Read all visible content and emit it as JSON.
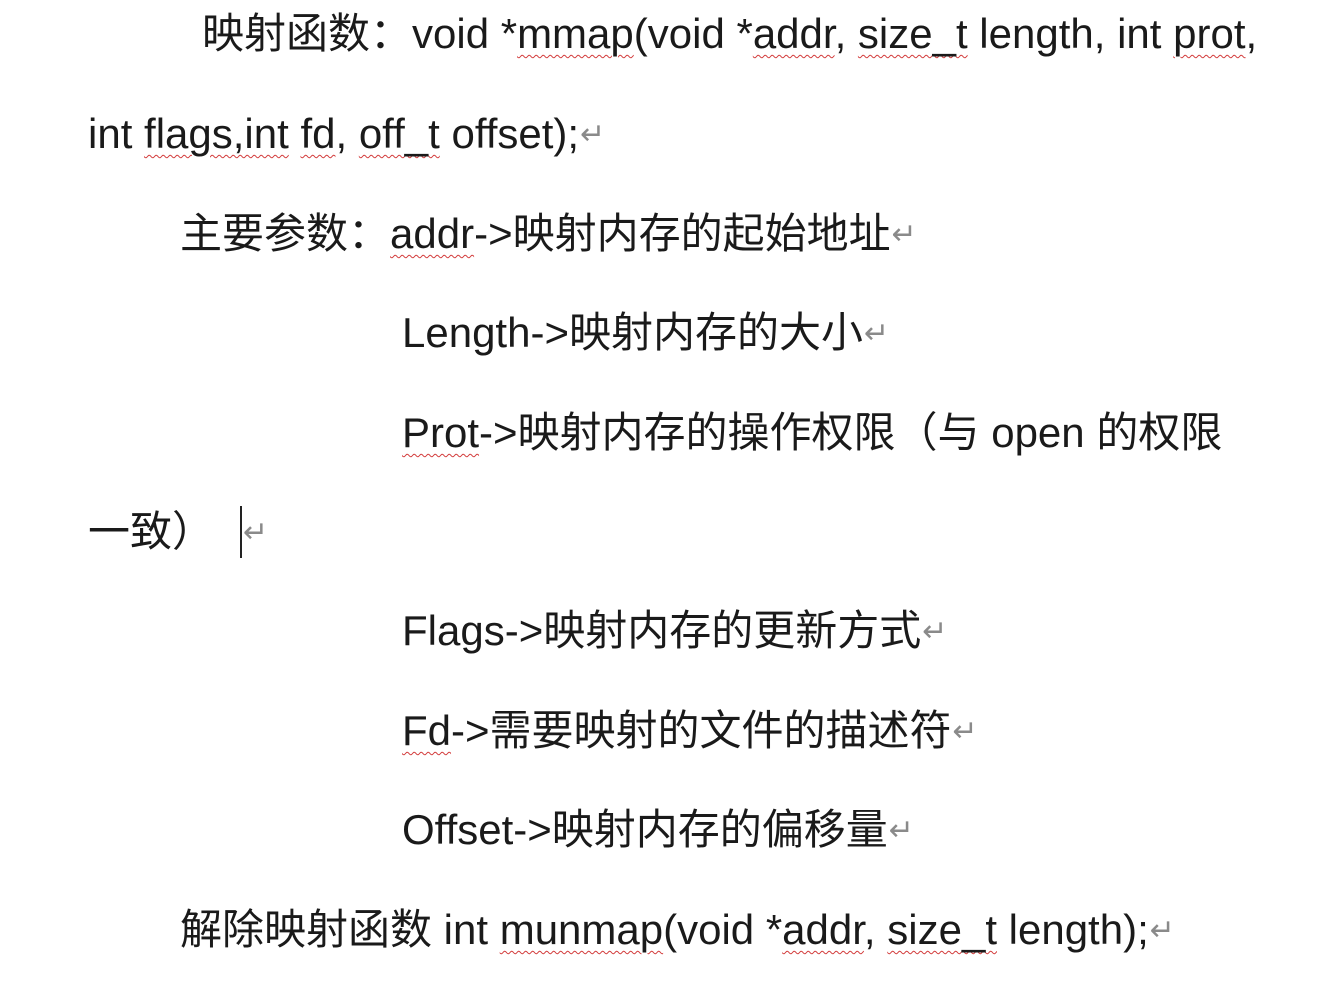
{
  "document": {
    "paragraphs": [
      {
        "id": "mmap-signature",
        "lines": [
          {
            "segments": [
              {
                "text": "映射函数：void *",
                "squiggle": false
              },
              {
                "text": "mmap",
                "squiggle": true
              },
              {
                "text": "(void *",
                "squiggle": false
              },
              {
                "text": "addr",
                "squiggle": true
              },
              {
                "text": ", ",
                "squiggle": false
              },
              {
                "text": "size_t",
                "squiggle": true
              },
              {
                "text": " length, int ",
                "squiggle": false
              },
              {
                "text": "prot",
                "squiggle": true
              },
              {
                "text": ",",
                "squiggle": false
              }
            ]
          },
          {
            "segments": [
              {
                "text": "int ",
                "squiggle": false
              },
              {
                "text": "flags,int",
                "squiggle": true
              },
              {
                "text": " ",
                "squiggle": false
              },
              {
                "text": "fd",
                "squiggle": true
              },
              {
                "text": ", ",
                "squiggle": false
              },
              {
                "text": "off_t",
                "squiggle": true
              },
              {
                "text": " offset);",
                "squiggle": false
              }
            ],
            "mark": "↵"
          }
        ]
      },
      {
        "id": "param-addr",
        "lines": [
          {
            "segments": [
              {
                "text": "主要参数：",
                "squiggle": false
              },
              {
                "text": "addr",
                "squiggle": true
              },
              {
                "text": "->映射内存的起始地址",
                "squiggle": false
              }
            ],
            "mark": "↵"
          }
        ]
      },
      {
        "id": "param-length",
        "lines": [
          {
            "segments": [
              {
                "text": "Length->映射内存的大小",
                "squiggle": false
              }
            ],
            "mark": "↵"
          }
        ]
      },
      {
        "id": "param-prot",
        "lines": [
          {
            "segments": [
              {
                "text": "Prot",
                "squiggle": true
              },
              {
                "text": "->映射内存的操作权限（与 open 的权限",
                "squiggle": false
              }
            ]
          },
          {
            "segments": [
              {
                "text": "一致）",
                "squiggle": false
              }
            ],
            "mark": "↵",
            "caret": true
          }
        ]
      },
      {
        "id": "param-flags",
        "lines": [
          {
            "segments": [
              {
                "text": "Flags->映射内存的更新方式",
                "squiggle": false
              }
            ],
            "mark": "↵"
          }
        ]
      },
      {
        "id": "param-fd",
        "lines": [
          {
            "segments": [
              {
                "text": "Fd",
                "squiggle": true
              },
              {
                "text": "->需要映射的文件的描述符",
                "squiggle": false
              }
            ],
            "mark": "↵"
          }
        ]
      },
      {
        "id": "param-offset",
        "lines": [
          {
            "segments": [
              {
                "text": "Offset->映射内存的偏移量",
                "squiggle": false
              }
            ],
            "mark": "↵"
          }
        ]
      },
      {
        "id": "munmap-signature",
        "lines": [
          {
            "segments": [
              {
                "text": "解除映射函数 int ",
                "squiggle": false
              },
              {
                "text": "munmap",
                "squiggle": true
              },
              {
                "text": "(void *",
                "squiggle": false
              },
              {
                "text": "addr",
                "squiggle": true
              },
              {
                "text": ", ",
                "squiggle": false
              },
              {
                "text": "size_t",
                "squiggle": true
              },
              {
                "text": " length);",
                "squiggle": false
              }
            ],
            "mark": "↵"
          }
        ]
      }
    ]
  },
  "colors": {
    "text": "#1a1a1a",
    "spellcheck_underline": "#d23a3a",
    "formatting_mark": "#8a8a8a",
    "background": "#ffffff"
  }
}
